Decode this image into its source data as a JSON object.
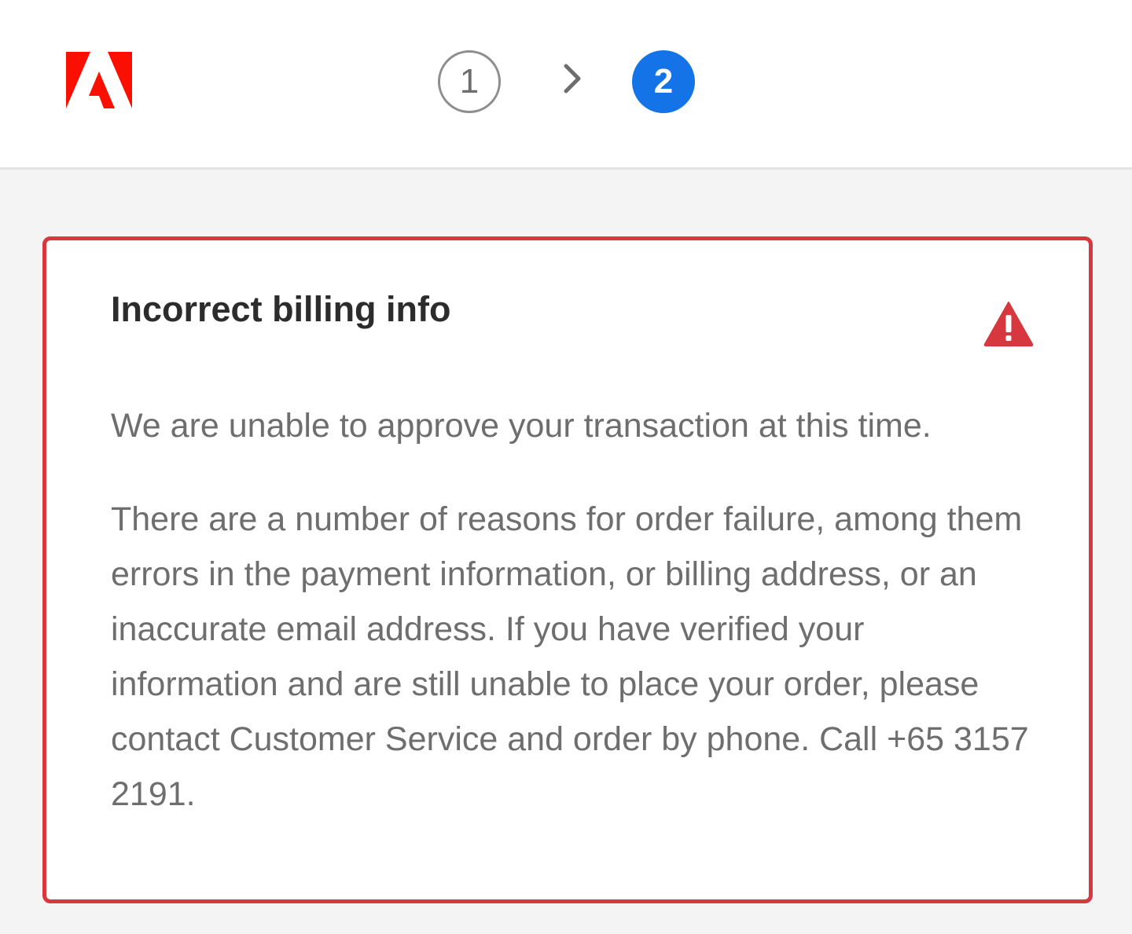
{
  "header": {
    "logo_icon": "adobe-logo-icon",
    "brand_color": "#fa0f00",
    "steps": [
      {
        "number": "1",
        "state": "completed"
      },
      {
        "number": "2",
        "state": "current"
      }
    ],
    "step_separator_icon": "chevron-right-icon",
    "active_step_color": "#1473e6"
  },
  "error_card": {
    "title": "Incorrect billing info",
    "alert_icon": "alert-triangle-icon",
    "alert_color": "#d7373f",
    "message": "We are unable to approve your transaction at this time.",
    "details": "There are a number of reasons for order failure, among them errors in the payment information, or billing address, or an inaccurate email address. If you have verified your information and are still unable to place your order, please contact Customer Service and order by phone. Call +65 3157 2191."
  }
}
